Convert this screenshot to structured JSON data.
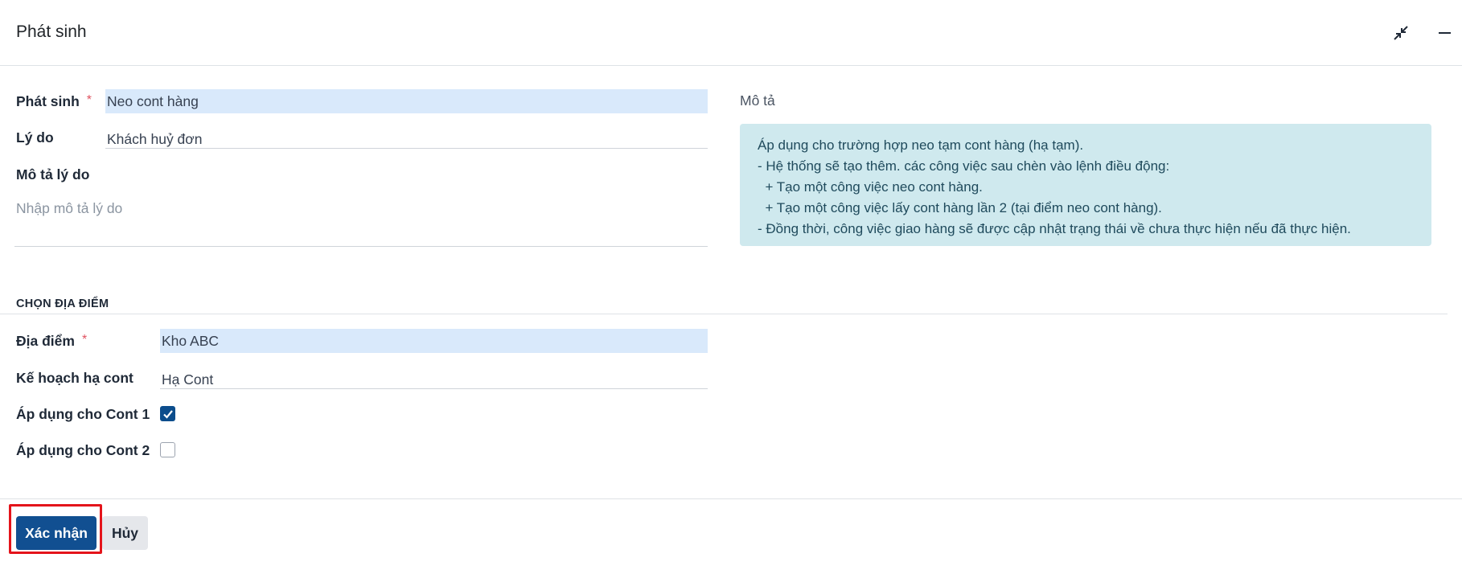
{
  "dialog": {
    "title": "Phát sinh"
  },
  "form": {
    "phat_sinh": {
      "label": "Phát sinh",
      "required_mark": "*",
      "value": "Neo cont hàng"
    },
    "ly_do": {
      "label": "Lý do",
      "value": "Khách huỷ đơn"
    },
    "mo_ta_ly_do": {
      "label": "Mô tả lý do",
      "placeholder": "Nhập mô tả lý do"
    }
  },
  "description": {
    "label": "Mô tả",
    "lines": [
      "Áp dụng cho trường hợp neo tạm cont hàng (hạ tạm).",
      "- Hệ thống sẽ tạo thêm. các công việc sau chèn vào lệnh điều động:",
      "  + Tạo một công việc neo cont hàng.",
      "  + Tạo một công việc lấy cont hàng lần 2 (tại điểm neo cont hàng).",
      "- Đồng thời, công việc giao hàng sẽ được cập nhật trạng thái về chưa thực hiện nếu đã thực hiện."
    ]
  },
  "location_section": {
    "title": "CHỌN ĐỊA ĐIỂM",
    "dia_diem": {
      "label": "Địa điểm",
      "required_mark": "*",
      "value": "Kho ABC"
    },
    "ke_hoach": {
      "label": "Kế hoạch hạ cont",
      "value": "Hạ Cont"
    },
    "cont1": {
      "label": "Áp dụng cho Cont 1",
      "checked": true
    },
    "cont2": {
      "label": "Áp dụng cho Cont 2",
      "checked": false
    }
  },
  "footer": {
    "confirm_label": "Xác nhận",
    "cancel_label": "Hủy"
  },
  "colors": {
    "primary": "#114f91",
    "info_bg": "#cfe9ee",
    "highlight_field": "#d9e9fb",
    "focus_ring": "#e4141b"
  }
}
